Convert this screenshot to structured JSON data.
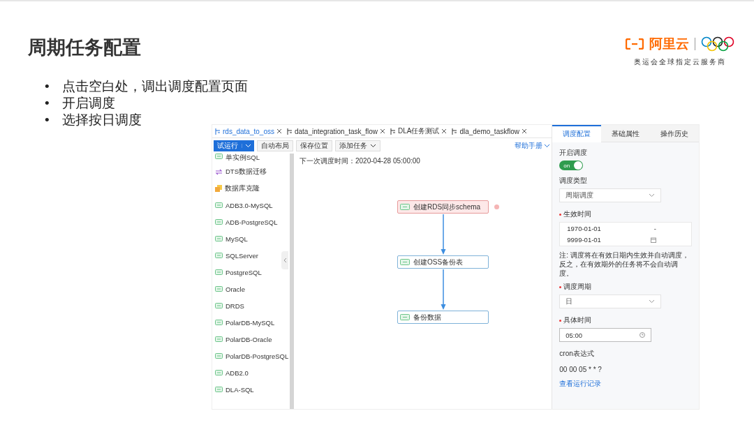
{
  "slide": {
    "title": "周期任务配置",
    "logo": {
      "name": "阿里云",
      "tagline": "奥运会全球指定云服务商"
    },
    "bullets": [
      {
        "marker": "•",
        "text": "点击空白处，调出调度配置页面"
      },
      {
        "marker": "•",
        "text": "开启调度"
      },
      {
        "marker": "•",
        "text": "选择按日调度"
      }
    ]
  },
  "app": {
    "tabs": [
      {
        "label": "rds_data_to_oss",
        "selected": true
      },
      {
        "label": "data_integration_task_flow",
        "selected": false
      },
      {
        "label": "DLA任务测试",
        "selected": false
      },
      {
        "label": "dla_demo_taskflow",
        "selected": false
      }
    ],
    "toolbar": {
      "run_button": "试运行",
      "buttons": [
        {
          "label": "自动布局",
          "dropdown": false
        },
        {
          "label": "保存位置",
          "dropdown": false
        },
        {
          "label": "添加任务",
          "dropdown": true
        }
      ],
      "help_link": "帮助手册"
    },
    "sidebar": {
      "items": [
        {
          "label": "单实例SQL",
          "kind": "sql"
        },
        {
          "label": "DTS数据迁移",
          "kind": "dts"
        },
        {
          "label": "数据库克隆",
          "kind": "clone"
        },
        {
          "label": "ADB3.0-MySQL",
          "kind": "sql"
        },
        {
          "label": "ADB-PostgreSQL",
          "kind": "sql"
        },
        {
          "label": "MySQL",
          "kind": "sql"
        },
        {
          "label": "SQLServer",
          "kind": "sql"
        },
        {
          "label": "PostgreSQL",
          "kind": "sql"
        },
        {
          "label": "Oracle",
          "kind": "sql"
        },
        {
          "label": "DRDS",
          "kind": "sql"
        },
        {
          "label": "PolarDB-MySQL",
          "kind": "sql"
        },
        {
          "label": "PolarDB-Oracle",
          "kind": "sql"
        },
        {
          "label": "PolarDB-PostgreSQL",
          "kind": "sql"
        },
        {
          "label": "ADB2.0",
          "kind": "sql"
        },
        {
          "label": "DLA-SQL",
          "kind": "sql"
        }
      ]
    },
    "canvas": {
      "next_run": "下一次调度时间：2020-04-28 05:00:00",
      "nodes": [
        {
          "label": "创建RDS同步schema",
          "kind": "error"
        },
        {
          "label": "创建OSS备份表",
          "kind": "normal"
        },
        {
          "label": "备份数据",
          "kind": "normal"
        }
      ]
    },
    "panel": {
      "tabs": [
        {
          "label": "调度配置",
          "selected": true
        },
        {
          "label": "基础属性",
          "selected": false
        },
        {
          "label": "操作历史",
          "selected": false
        }
      ],
      "schedule_switch": {
        "label": "开启调度",
        "text": "on",
        "on": true
      },
      "schedule_type": {
        "label": "调度类型",
        "value": "周期调度"
      },
      "effective_time": {
        "label": "生效时间",
        "required": true,
        "start": "1970-01-01",
        "separator": "-",
        "end": "9999-01-01"
      },
      "note": "注: 调度将在有效日期内生效并自动调度，反之，在有效期外的任务将不会自动调度。",
      "period": {
        "label": "调度周期",
        "required": true,
        "value": "日"
      },
      "time": {
        "label": "具体时间",
        "required": true,
        "value": "05:00"
      },
      "cron": {
        "label": "cron表达式",
        "value": "00 00 05 * * ?"
      },
      "history_link": "查看运行记录"
    }
  }
}
